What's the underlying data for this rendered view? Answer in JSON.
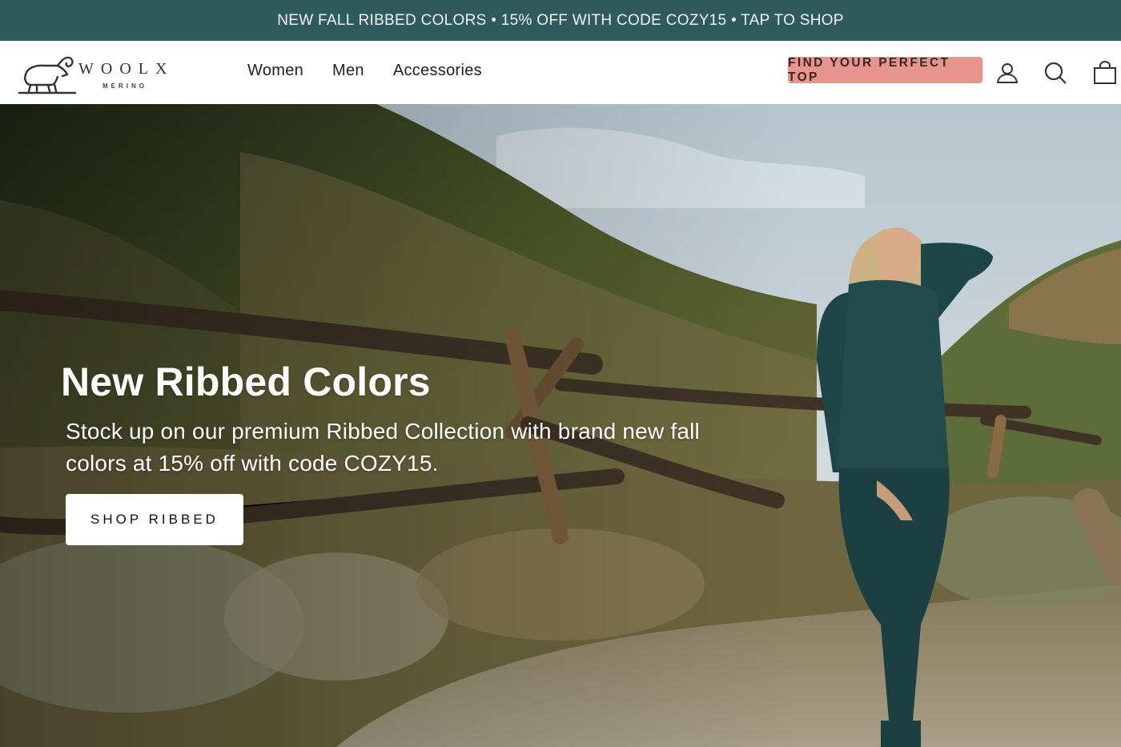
{
  "announcement": {
    "text": "NEW FALL RIBBED COLORS • 15% OFF WITH CODE COZY15 • TAP TO SHOP"
  },
  "header": {
    "logo": {
      "wordmark": "WOOLX",
      "sub": "MERINO"
    },
    "nav": [
      {
        "label": "Women"
      },
      {
        "label": "Men"
      },
      {
        "label": "Accessories"
      }
    ],
    "cta_label": "FIND YOUR PERFECT TOP",
    "icons": [
      "account-icon",
      "search-icon",
      "cart-icon"
    ]
  },
  "hero": {
    "title": "New Ribbed Colors",
    "subtitle": "Stock up on our premium Ribbed Collection with brand new fall colors at 15% off with code COZY15.",
    "button_label": "SHOP RIBBED"
  },
  "colors": {
    "announcement_bg": "#2f5c5b",
    "cta_bg": "#e7938e",
    "garment": "#1f4548"
  }
}
